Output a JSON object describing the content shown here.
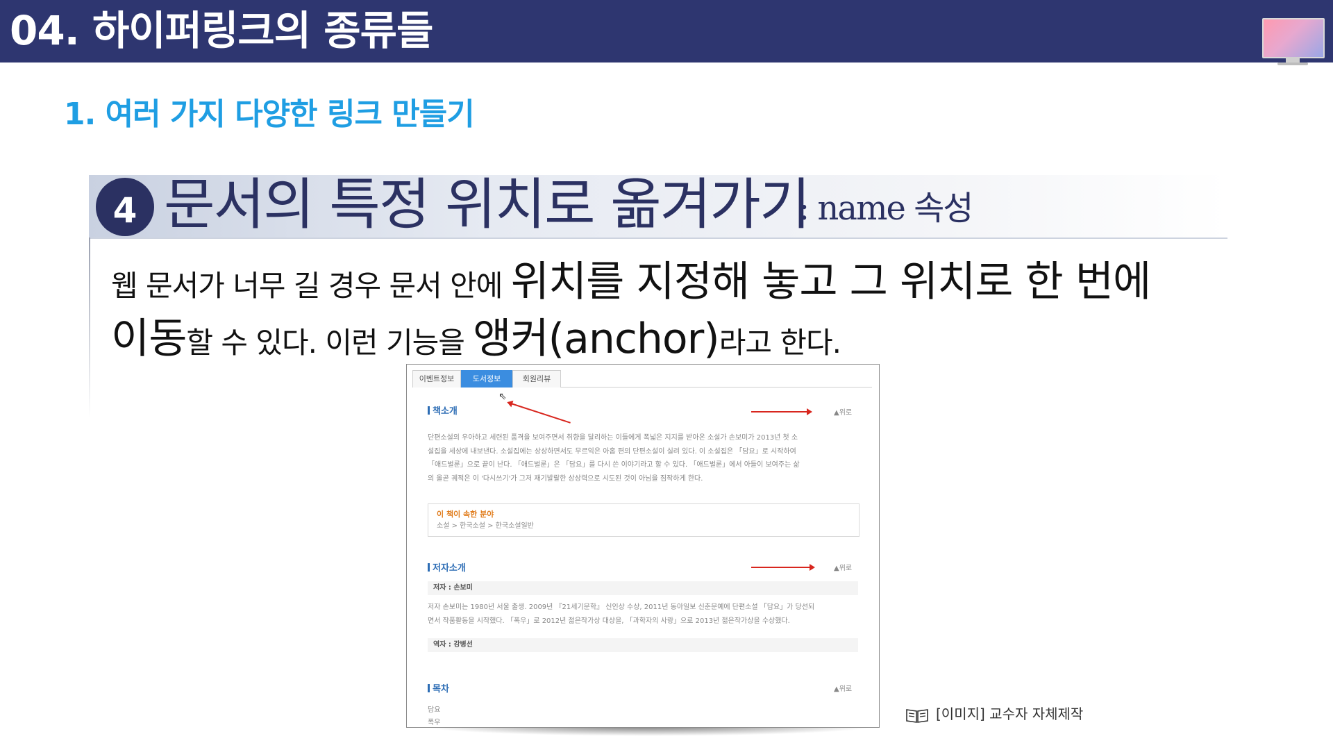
{
  "header": {
    "title": "04. 하이퍼링크의 종류들",
    "monitor_icon": "monitor-icon"
  },
  "subtitle": "1. 여러 가지 다양한 링크 만들기",
  "section": {
    "number": "4",
    "title": "문서의 특정 위치로 옮겨가기",
    "suffix": ": name 속성"
  },
  "body": {
    "p1_small": "웹 문서가 너무 길 경우 문서 안에 ",
    "p1_big": "위치를 지정해 놓고 그 위치로 한 번에",
    "p2_big": "이동",
    "p2_small": "할 수 있다. 이런 기능을 ",
    "p2_big2": "앵커(anchor)",
    "p2_small2": "라고 한다."
  },
  "screenshot": {
    "tabs": [
      "이벤트정보",
      "도서정보",
      "회원리뷰"
    ],
    "active_tab": "도서정보",
    "up_label": "▲위로",
    "sections": [
      {
        "heading": "책소개"
      },
      {
        "heading": "저자소개"
      },
      {
        "heading": "목차"
      }
    ],
    "book_intro": [
      "단편소설의 우아하고 세련된 품격을 보여주면서 취향을 달리하는 이들에게 폭넓은 지지를 받아온 소설가 손보미가 2013년 첫 소",
      "설집을 세상에 내보낸다. 소설집에는 상상하면서도 무르익은 아홉 편의 단편소설이 실려 있다. 이 소설집은 「담요」로 시작하여",
      "「애드벌룬」으로 끝이 난다. 「애드벌룬」은 「담요」를 다시 쓴 이야기라고 할 수 있다. 「애드벌룬」에서 아들이 보여주는 삶",
      "의 올곧 궤적은 이 '다시쓰기'가 그저 재기발랄한 상상력으로 시도된 것이 아님을 짐작하게 한다."
    ],
    "field": {
      "title": "이 책이 속한 분야",
      "path": "소설 > 한국소설 > 한국소설일반"
    },
    "author_label": "저자 : 손보미",
    "author_bio": [
      "저자 손보미는 1980년 서울 출생. 2009년 『21세기문학』 신인상 수상, 2011년 동아일보 신춘문예에 단편소설 「담요」가 당선되",
      "면서 작품활동을 시작했다. 「폭우」로 2012년 젊은작가상 대상을, 「과학자의 사랑」으로 2013년 젊은작가상을 수상했다."
    ],
    "translator_label": "역자 : 강병선",
    "toc": [
      "담요",
      "폭우"
    ]
  },
  "caption": {
    "text": "[이미지] 교수자 자체제작",
    "icon": "book-icon"
  }
}
